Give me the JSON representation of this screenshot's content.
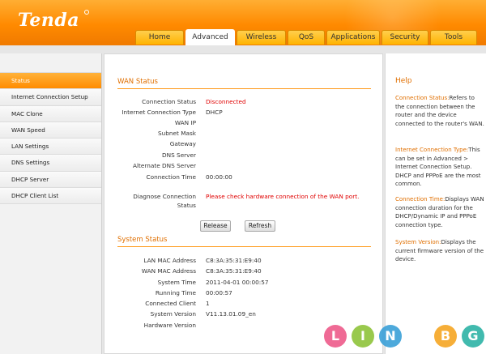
{
  "brand": {
    "logo_text": "Tenda"
  },
  "nav": {
    "tabs": [
      {
        "label": "Home"
      },
      {
        "label": "Advanced"
      },
      {
        "label": "Wireless"
      },
      {
        "label": "QoS"
      },
      {
        "label": "Applications"
      },
      {
        "label": "Security"
      },
      {
        "label": "Tools"
      }
    ],
    "active_tab": "Advanced"
  },
  "sidebar": {
    "items": [
      {
        "label": "Status"
      },
      {
        "label": "Internet Connection Setup"
      },
      {
        "label": "MAC Clone"
      },
      {
        "label": "WAN Speed"
      },
      {
        "label": "LAN Settings"
      },
      {
        "label": "DNS Settings"
      },
      {
        "label": "DHCP Server"
      },
      {
        "label": "DHCP Client List"
      }
    ],
    "active_item": "Status"
  },
  "wan": {
    "title": "WAN Status",
    "rows": [
      {
        "label": "Connection Status",
        "value": "Disconnected"
      },
      {
        "label": "Internet Connection Type",
        "value": "DHCP"
      },
      {
        "label": "WAN IP",
        "value": ""
      },
      {
        "label": "Subnet Mask",
        "value": ""
      },
      {
        "label": "Gateway",
        "value": ""
      },
      {
        "label": "DNS Server",
        "value": ""
      },
      {
        "label": "Alternate DNS Server",
        "value": ""
      },
      {
        "label": "Connection Time",
        "value": "00:00:00"
      }
    ],
    "diagnose": {
      "label_line1": "Diagnose Connection",
      "label_line2": "Status",
      "value": "Please check hardware connection of the WAN port."
    },
    "release_label": "Release",
    "refresh_label": "Refresh"
  },
  "system": {
    "title": "System Status",
    "rows": [
      {
        "label": "LAN MAC Address",
        "value": "C8:3A:35:31:E9:40"
      },
      {
        "label": "WAN MAC Address",
        "value": "C8:3A:35:31:E9:40"
      },
      {
        "label": "System Time",
        "value": "2011-04-01 00:00:57"
      },
      {
        "label": "Running Time",
        "value": "00:00:57"
      },
      {
        "label": "Connected Client",
        "value": "1"
      },
      {
        "label": "System Version",
        "value": "V11.13.01.09_en"
      },
      {
        "label": "Hardware Version",
        "value": ""
      }
    ]
  },
  "help": {
    "title": "Help",
    "entries": [
      {
        "term": "Connection Status:",
        "text": "Refers to the connection between the router and the device connected to the router's WAN."
      },
      {
        "term": "Internet Connection Type:",
        "text": "This can be set in Advanced > Internet Connection Setup. DHCP and PPPoE are the most common."
      },
      {
        "term": "Connection Time:",
        "text": "Displays WAN connection duration for the DHCP/Dynamic IP and PPPoE connection type."
      },
      {
        "term": "System Version:",
        "text": "Displays the current firmware version of the device."
      }
    ]
  },
  "watermark": {
    "letters": [
      {
        "char": "L",
        "color": "#ee5a8a"
      },
      {
        "char": "I",
        "color": "#8fc43a"
      },
      {
        "char": "N",
        "color": "#3aa0d8"
      },
      {
        "char": "B",
        "color": "#f6a623"
      },
      {
        "char": "G",
        "color": "#2db3a6"
      }
    ]
  },
  "colors": {
    "accent": "#ff8c00",
    "title": "#e06f00",
    "error": "#e00000"
  }
}
